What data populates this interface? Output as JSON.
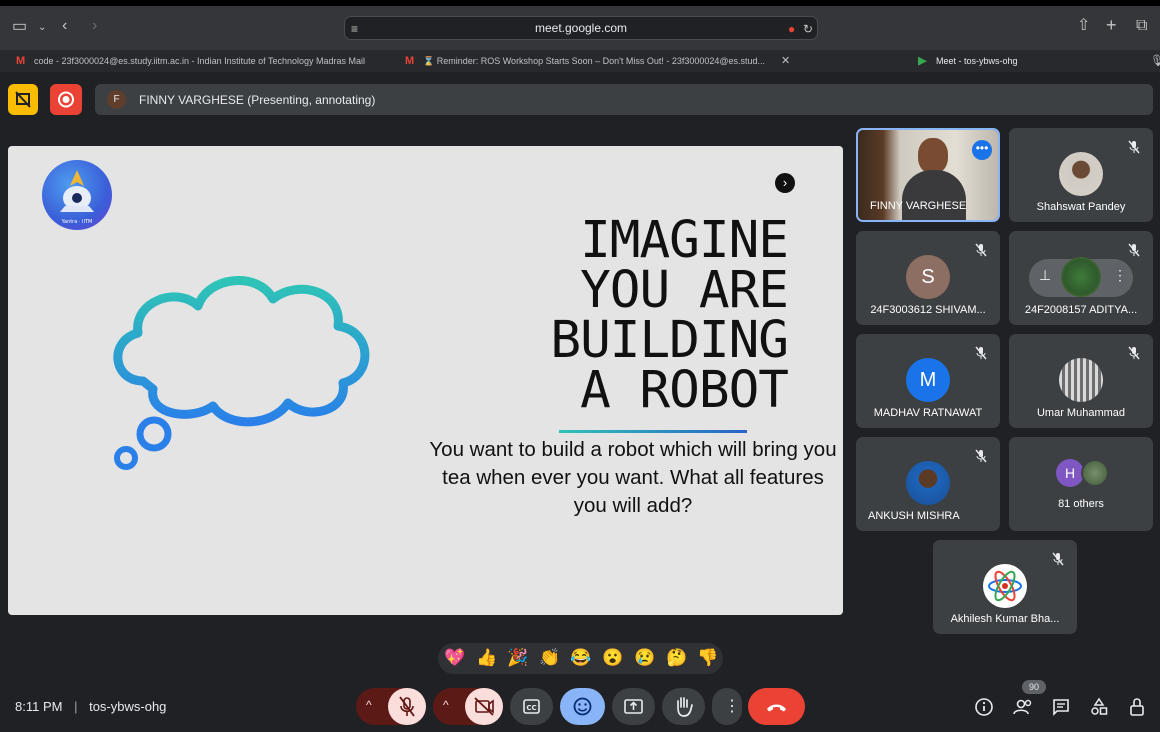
{
  "browser": {
    "url": "meet.google.com",
    "tabs": [
      {
        "label": "code - 23f3000024@es.study.iitm.ac.in - Indian Institute of Technology Madras Mail",
        "favicon": "gmail-icon"
      },
      {
        "label": "⌛ Reminder: ROS Workshop Starts Soon – Don't Miss Out! - 23f3000024@es.stud...",
        "favicon": "gmail-icon"
      },
      {
        "label": "Meet - tos-ybws-ohg",
        "favicon": "meet-icon"
      }
    ]
  },
  "presenter_bar": {
    "avatar_initial": "F",
    "text": "FINNY VARGHESE (Presenting, annotating)"
  },
  "slide": {
    "logo_text": "Yantra · IITM",
    "headline": [
      "IMAGINE",
      "YOU ARE",
      "BUILDING",
      "A ROBOT"
    ],
    "body": "You want to build a robot which will bring you tea when ever you want. What all features you will add?"
  },
  "participants": [
    {
      "name": "FINNY VARGHESE",
      "type": "video",
      "active": true
    },
    {
      "name": "Shahswat Pandey",
      "type": "photo",
      "muted": true
    },
    {
      "name": "24F3003612 SHIVAM...",
      "type": "initial",
      "initial": "S",
      "color": "#8d6e63",
      "muted": true
    },
    {
      "name": "24F2008157 ADITYA...",
      "type": "photo",
      "muted": true
    },
    {
      "name": "MADHAV RATNAWAT",
      "type": "initial",
      "initial": "M",
      "color": "#1a73e8",
      "muted": true
    },
    {
      "name": "Umar Muhammad",
      "type": "photo",
      "muted": true
    },
    {
      "name": "ANKUSH MISHRA",
      "type": "photo",
      "muted": true
    },
    {
      "name": "81 others",
      "type": "others",
      "initial": "H"
    },
    {
      "name": "Akhilesh Kumar Bha...",
      "type": "photo",
      "muted": true
    }
  ],
  "reactions": [
    "💖",
    "👍",
    "🎉",
    "👏",
    "😂",
    "😮",
    "😢",
    "🤔",
    "👎"
  ],
  "bottom": {
    "time": "8:11 PM",
    "meeting_code": "tos-ybws-ohg",
    "people_count": "90"
  },
  "colors": {
    "background": "#202124",
    "tile": "#3c4043",
    "end_call": "#ea4335",
    "mic_off_bg": "#f9dedc",
    "reaction_active": "#8ab4f8"
  }
}
